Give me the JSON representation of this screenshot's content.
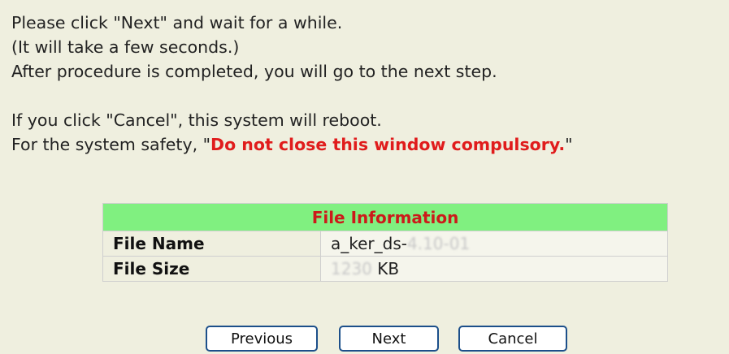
{
  "instructions": {
    "line1": "Please click \"Next\" and wait for a while.",
    "line2": "(It will take a few seconds.)",
    "line3": "After procedure is completed, you will go to the next step.",
    "line4": "If you click \"Cancel\", this system will reboot.",
    "line5_prefix": "For the system safety, \"",
    "line5_warning": "Do not close this window compulsory.",
    "line5_suffix": "\""
  },
  "file_info": {
    "title": "File Information",
    "rows": [
      {
        "label": "File Name",
        "value_prefix": "a_ker_ds-",
        "value_obscured": "4.10-01",
        "value_suffix": ""
      },
      {
        "label": "File Size",
        "value_prefix": "",
        "value_obscured": "1230",
        "value_suffix": " KB"
      }
    ]
  },
  "buttons": {
    "previous": "Previous",
    "next": "Next",
    "cancel": "Cancel"
  },
  "colors": {
    "page_background": "#efefdf",
    "table_header_background": "#80f080",
    "warning": "#e01c1c",
    "button_border": "#1c4f8a"
  }
}
